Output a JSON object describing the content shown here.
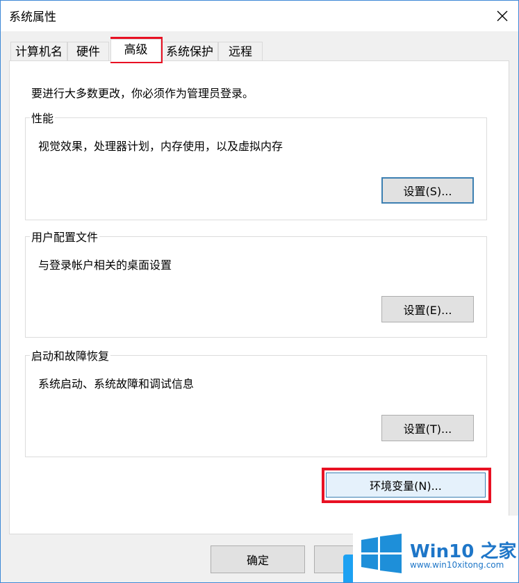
{
  "window": {
    "title": "系统属性"
  },
  "tabs": [
    {
      "label": "计算机名"
    },
    {
      "label": "硬件"
    },
    {
      "label": "高级",
      "active": true
    },
    {
      "label": "系统保护"
    },
    {
      "label": "远程"
    }
  ],
  "advanced": {
    "admin_note": "要进行大多数更改，你必须作为管理员登录。",
    "performance": {
      "title": "性能",
      "description": "视觉效果，处理器计划，内存使用，以及虚拟内存",
      "button": "设置(S)..."
    },
    "user_profiles": {
      "title": "用户配置文件",
      "description": "与登录帐户相关的桌面设置",
      "button": "设置(E)..."
    },
    "startup_recovery": {
      "title": "启动和故障恢复",
      "description": "系统启动、系统故障和调试信息",
      "button": "设置(T)..."
    },
    "env_button": "环境变量(N)..."
  },
  "footer": {
    "ok": "确定"
  },
  "watermark": {
    "brand": "Win10 之家",
    "url": "www.win10xitong.com"
  },
  "colors": {
    "highlight": "#e81123",
    "accent": "#1e76c8",
    "window_border": "#3d88d6"
  }
}
